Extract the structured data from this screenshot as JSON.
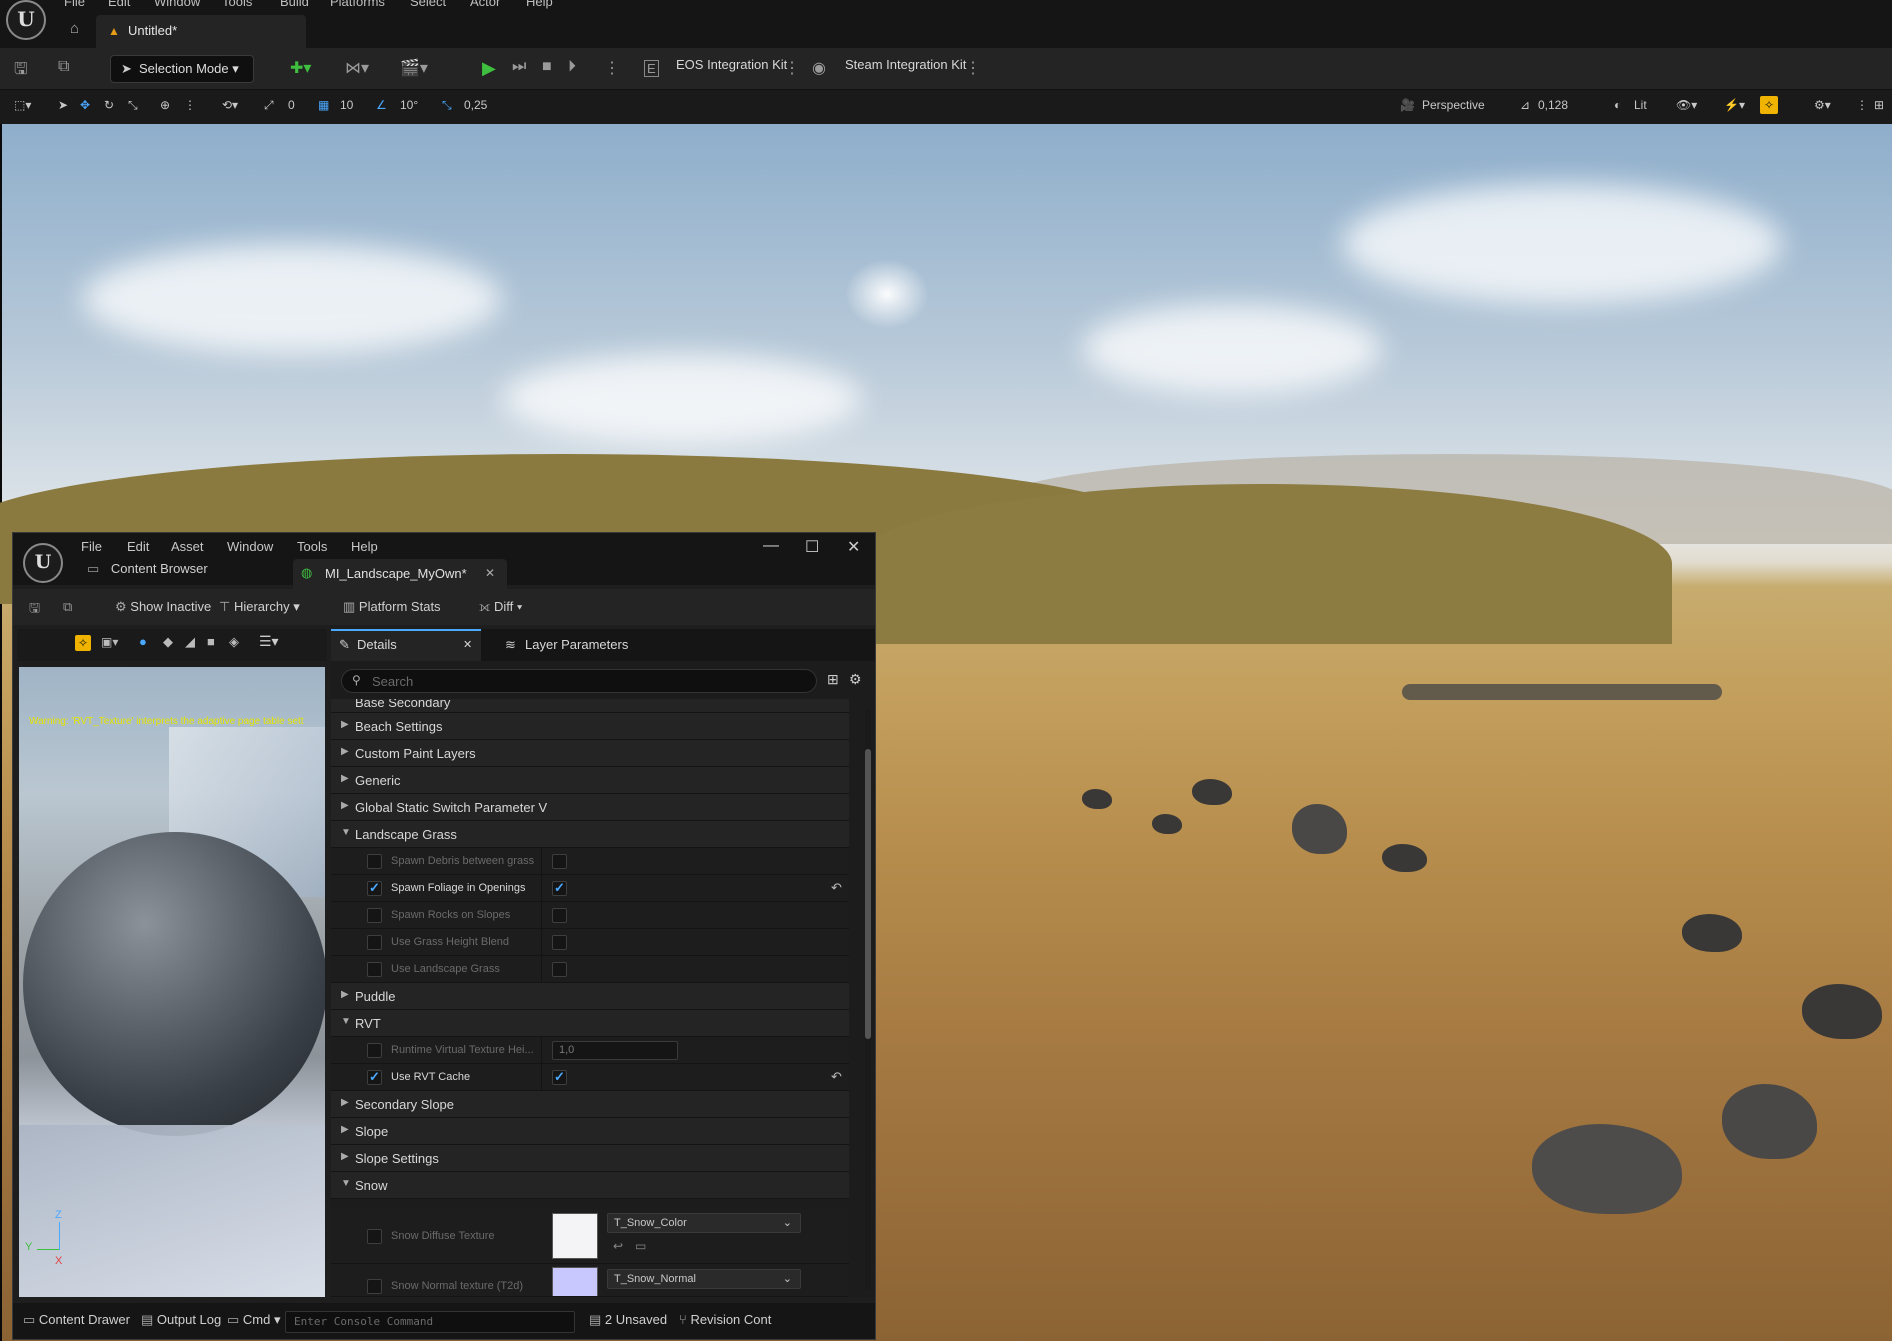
{
  "main_menu": [
    "File",
    "Edit",
    "Window",
    "Tools",
    "Build",
    "Platforms",
    "Select",
    "Actor",
    "Help"
  ],
  "document_tab": "Untitled*",
  "toolbar": {
    "mode": "Selection Mode",
    "eos": "EOS Integration Kit",
    "steam": "Steam Integration Kit"
  },
  "viewport_toolbar": {
    "rot_snap": "0",
    "grid": "10",
    "angle": "10°",
    "scale": "0,25",
    "perspective": "Perspective",
    "camera_speed": "0,128",
    "view_mode": "Lit"
  },
  "editor": {
    "menu": [
      "File",
      "Edit",
      "Asset",
      "Window",
      "Tools",
      "Help"
    ],
    "tabs": {
      "content_browser": "Content Browser",
      "material": "MI_Landscape_MyOwn*"
    },
    "toolbar": {
      "show_inactive": "Show Inactive",
      "hierarchy": "Hierarchy",
      "platform_stats": "Platform Stats",
      "diff": "Diff"
    },
    "preview_warning": "Warning: 'RVT_Texture' interprets the adaptive page table sett",
    "details_tab": "Details",
    "layer_params_tab": "Layer Parameters",
    "search_placeholder": "Search",
    "cut_top": "Base Secondary",
    "rows": [
      {
        "kind": "cat",
        "label": "Beach Settings",
        "open": false
      },
      {
        "kind": "cat",
        "label": "Custom Paint Layers",
        "open": false
      },
      {
        "kind": "cat",
        "label": "Generic",
        "open": false
      },
      {
        "kind": "cat",
        "label": "Global Static Switch Parameter V",
        "open": false
      },
      {
        "kind": "cat",
        "label": "Landscape Grass",
        "open": true
      },
      {
        "kind": "prop",
        "label": "Spawn Debris between grass",
        "on": false
      },
      {
        "kind": "prop",
        "label": "Spawn Foliage in Openings",
        "on": true
      },
      {
        "kind": "prop",
        "label": "Spawn Rocks on Slopes",
        "on": false
      },
      {
        "kind": "prop",
        "label": "Use Grass Height Blend",
        "on": false
      },
      {
        "kind": "prop",
        "label": "Use Landscape Grass",
        "on": false
      },
      {
        "kind": "cat",
        "label": "Puddle",
        "open": false
      },
      {
        "kind": "cat",
        "label": "RVT",
        "open": true
      },
      {
        "kind": "num",
        "label": "Runtime Virtual Texture Hei...",
        "value": "1,0"
      },
      {
        "kind": "prop",
        "label": "Use RVT Cache",
        "on": true
      },
      {
        "kind": "cat",
        "label": "Secondary Slope",
        "open": false
      },
      {
        "kind": "cat",
        "label": "Slope",
        "open": false
      },
      {
        "kind": "cat",
        "label": "Slope Settings",
        "open": false
      },
      {
        "kind": "cat",
        "label": "Snow",
        "open": true
      }
    ],
    "snow_diffuse": {
      "label": "Snow Diffuse Texture",
      "asset": "T_Snow_Color"
    },
    "snow_normal": {
      "label": "Snow Normal texture (T2d)",
      "asset": "T_Snow_Normal"
    },
    "status": {
      "content_drawer": "Content Drawer",
      "output_log": "Output Log",
      "cmd": "Cmd",
      "console_placeholder": "Enter Console Command",
      "unsaved": "2 Unsaved",
      "revision": "Revision Cont"
    }
  },
  "colors": {
    "accent": "#4aa8ff",
    "warning": "#e39b18",
    "play": "#3fbf3f",
    "highlight": "#f0b400"
  }
}
